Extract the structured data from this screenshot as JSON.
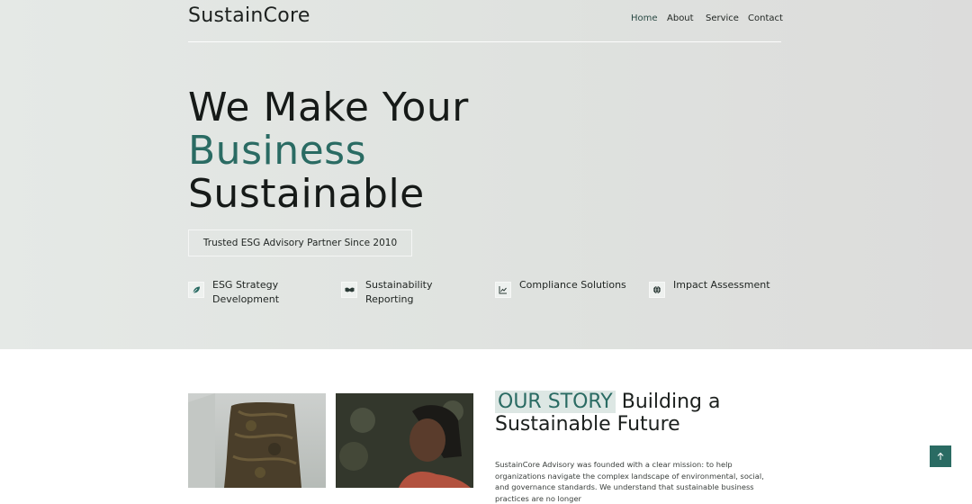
{
  "brand": "SustainCore",
  "nav": [
    "Home",
    "About",
    "Service",
    "Contact"
  ],
  "hero": {
    "line1": "We Make Your",
    "line2": "Business",
    "line3": "Sustainable",
    "trust": "Trusted ESG Advisory Partner Since 2010"
  },
  "services": [
    {
      "label": "ESG Strategy Development",
      "icon": "leaf-icon"
    },
    {
      "label": "Sustainability Reporting",
      "icon": "handshake-icon"
    },
    {
      "label": "Compliance Solutions",
      "icon": "chart-line-icon"
    },
    {
      "label": "Impact Assessment",
      "icon": "globe-icon"
    }
  ],
  "story": {
    "tag": "OUR STORY",
    "title_rest": " Building a",
    "title_line2": "Sustainable Future",
    "body": "SustainCore Advisory was founded with a clear mission: to help organizations navigate the complex landscape of environmental, social, and governance standards. We understand that sustainable business practices are no longer"
  },
  "colors": {
    "accent": "#2a6b63",
    "hero_bg": "#e2e5e2",
    "tag_bg": "#dde7e4"
  }
}
